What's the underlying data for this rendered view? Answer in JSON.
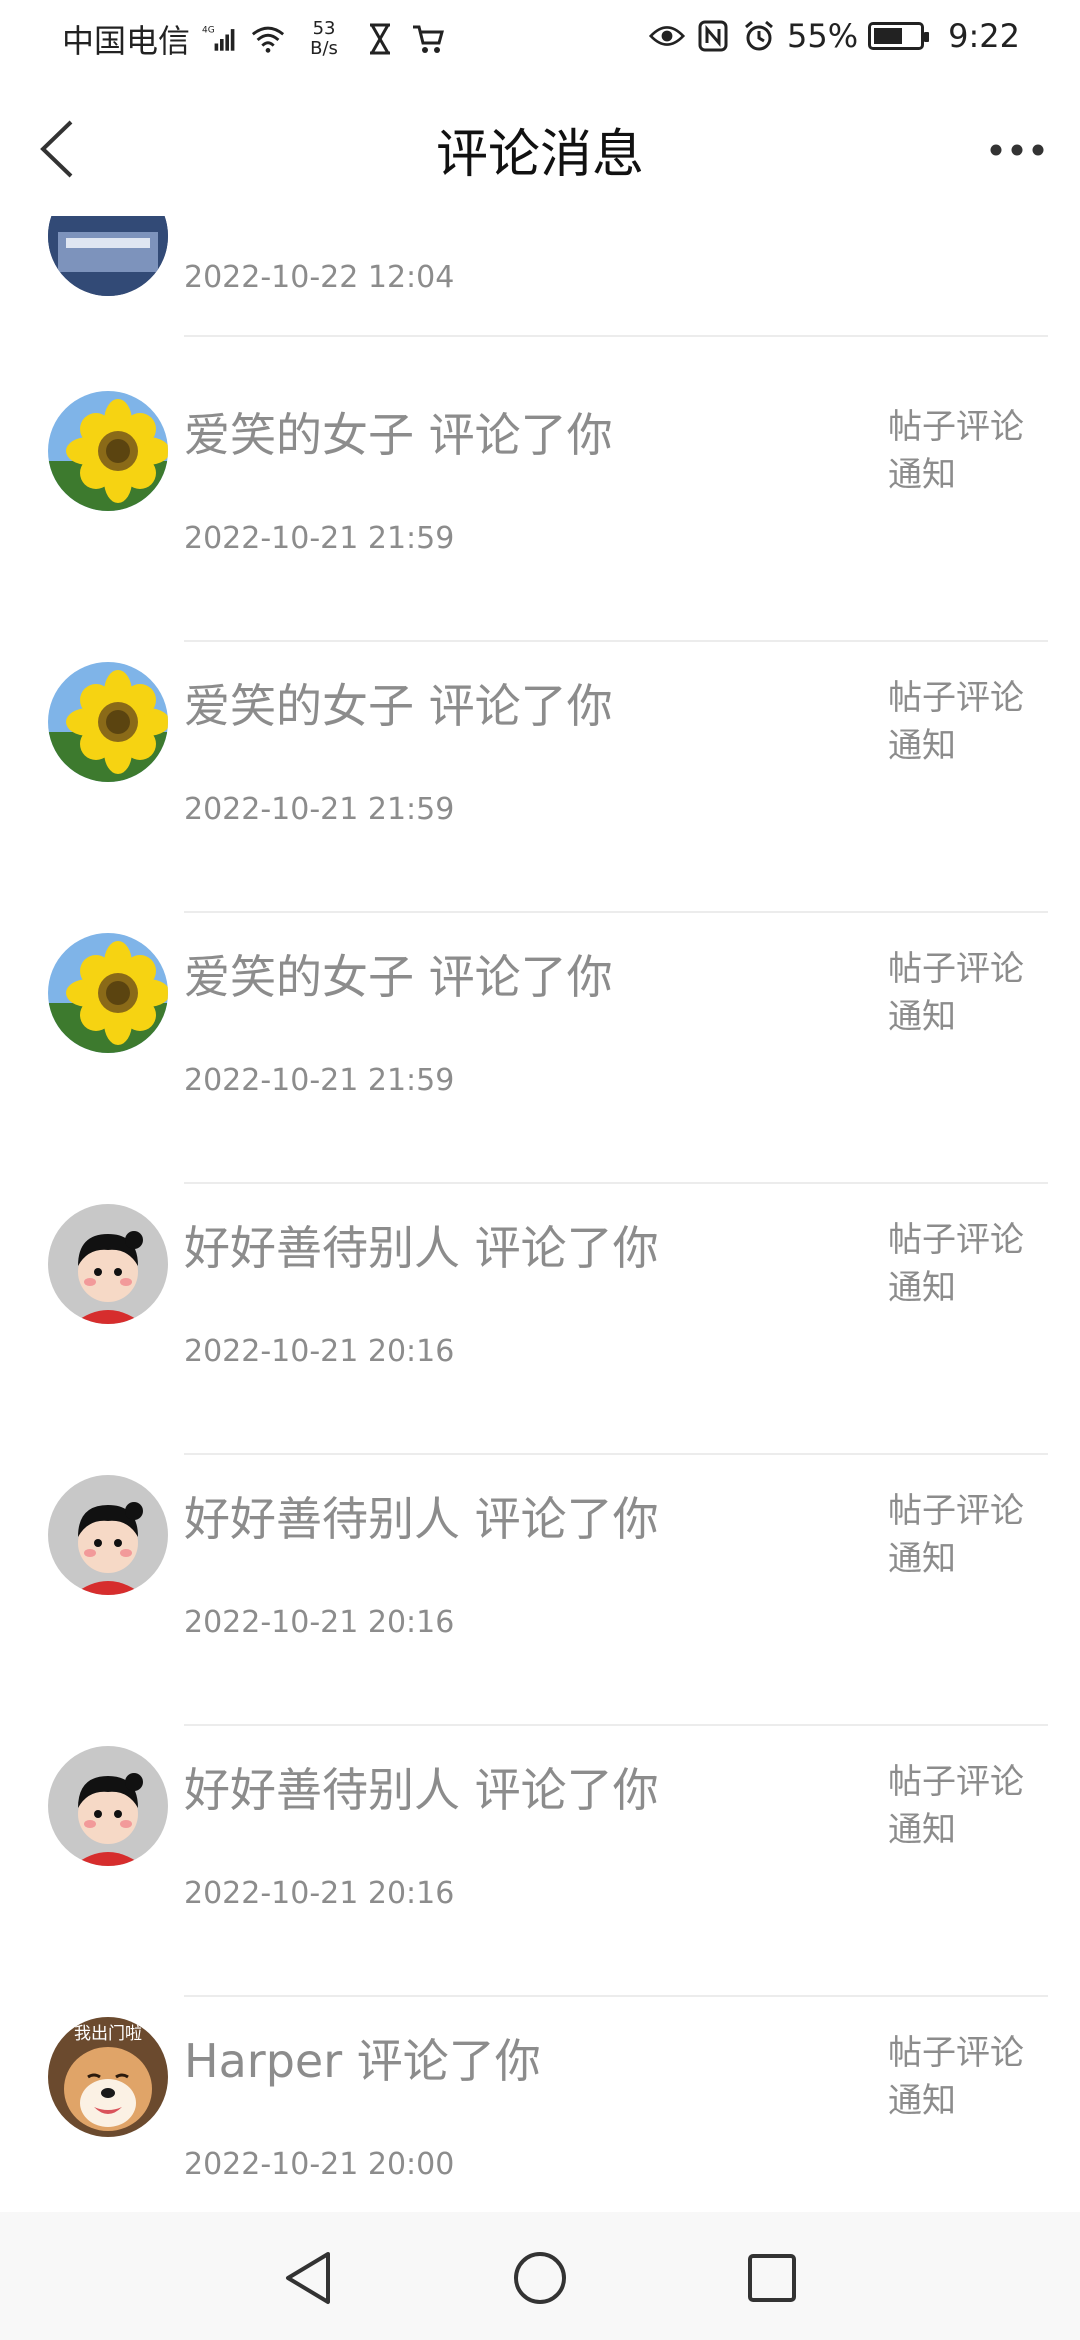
{
  "status_bar": {
    "carrier": "中国电信",
    "network": "4G",
    "speed_value": "53",
    "speed_unit": "B/s",
    "battery": "55%",
    "time": "9:22"
  },
  "header": {
    "title": "评论消息"
  },
  "first_item": {
    "time": "2022-10-22 12:04"
  },
  "items": [
    {
      "title": "爱笑的女子 评论了你",
      "time": "2022-10-21 21:59",
      "type_line1": "帖子评论",
      "type_line2": "通知",
      "avatar": "sunflower"
    },
    {
      "title": "爱笑的女子 评论了你",
      "time": "2022-10-21 21:59",
      "type_line1": "帖子评论",
      "type_line2": "通知",
      "avatar": "sunflower"
    },
    {
      "title": "爱笑的女子 评论了你",
      "time": "2022-10-21 21:59",
      "type_line1": "帖子评论",
      "type_line2": "通知",
      "avatar": "sunflower"
    },
    {
      "title": "好好善待别人 评论了你",
      "time": "2022-10-21 20:16",
      "type_line1": "帖子评论",
      "type_line2": "通知",
      "avatar": "cartoon-girl"
    },
    {
      "title": "好好善待别人 评论了你",
      "time": "2022-10-21 20:16",
      "type_line1": "帖子评论",
      "type_line2": "通知",
      "avatar": "cartoon-girl"
    },
    {
      "title": "好好善待别人 评论了你",
      "time": "2022-10-21 20:16",
      "type_line1": "帖子评论",
      "type_line2": "通知",
      "avatar": "cartoon-girl"
    },
    {
      "title": "Harper 评论了你",
      "time": "2022-10-21 20:00",
      "type_line1": "帖子评论",
      "type_line2": "通知",
      "avatar": "dog",
      "avatar_caption": "我出门啦"
    }
  ],
  "icons": {
    "back": "chevron-left-icon",
    "more": "more-dots-icon",
    "nav_back": "triangle-back-icon",
    "nav_home": "circle-home-icon",
    "nav_recent": "square-recent-icon"
  }
}
